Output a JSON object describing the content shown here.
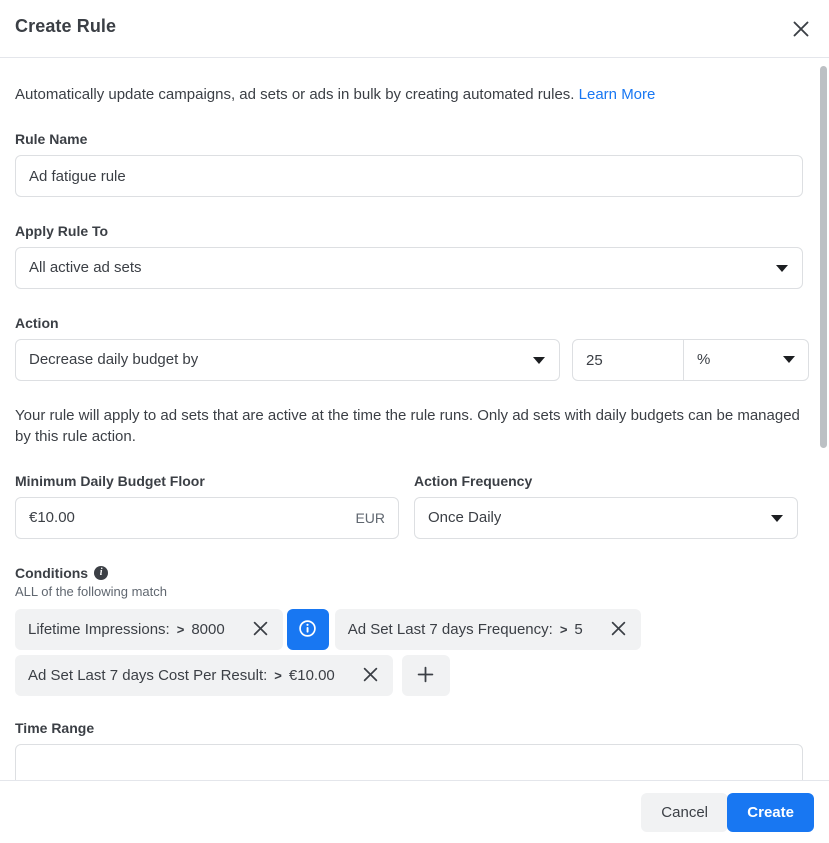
{
  "header": {
    "title": "Create Rule",
    "close_icon": "close-icon"
  },
  "intro": {
    "text": "Automatically update campaigns, ad sets or ads in bulk by creating automated rules.",
    "link_label": "Learn More"
  },
  "rule_name": {
    "label": "Rule Name",
    "value": "Ad fatigue rule",
    "placeholder": "Rule Name"
  },
  "apply_rule_to": {
    "label": "Apply Rule To",
    "value": "All active ad sets",
    "caret_icon": "chevron-down-icon"
  },
  "action": {
    "label": "Action",
    "value": "Decrease daily budget by",
    "amount": "25",
    "unit": "%",
    "helper_text": "Your rule will apply to ad sets that are active at the time the rule runs. Only ad sets with daily budgets can be managed by this rule action."
  },
  "min_budget": {
    "label": "Minimum Daily Budget Floor",
    "value": "€10.00",
    "currency": "EUR"
  },
  "action_frequency": {
    "label": "Action Frequency",
    "value": "Once Daily"
  },
  "conditions": {
    "label": "Conditions",
    "info_icon": "info-icon",
    "subtitle": "ALL of the following match",
    "rows": [
      {
        "chips": [
          {
            "metric": "Lifetime Impressions:",
            "operator": ">",
            "value": "8000",
            "remove_icon": "close-icon",
            "has_info_button": true,
            "info_icon": "info-icon"
          },
          {
            "metric": "Ad Set Last 7 days Frequency:",
            "operator": ">",
            "value": "5",
            "remove_icon": "close-icon",
            "has_info_button": false
          }
        ]
      },
      {
        "chips": [
          {
            "metric": "Ad Set Last 7 days Cost Per Result:",
            "operator": ">",
            "value": "€10.00",
            "remove_icon": "close-icon",
            "has_info_button": false
          }
        ],
        "add_button": {
          "icon": "plus-icon",
          "label": "+"
        }
      }
    ]
  },
  "time_range": {
    "label": "Time Range"
  },
  "footer": {
    "cancel_label": "Cancel",
    "create_label": "Create"
  },
  "colors": {
    "accent": "#1877f2",
    "chip_bg": "#f1f2f3",
    "text": "#3b3f45",
    "muted": "#606770",
    "border": "#dddfe2",
    "scrollbar": "#bcc0c4"
  },
  "scrollbar": {
    "name": "vertical-scrollbar"
  }
}
